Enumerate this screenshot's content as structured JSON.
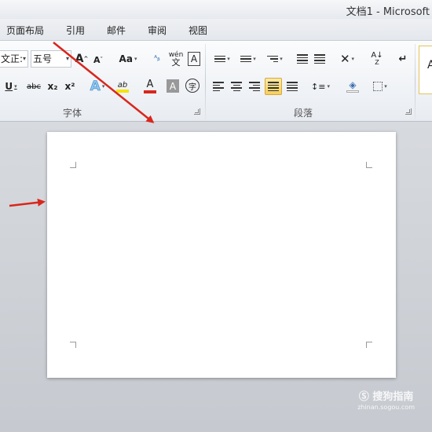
{
  "window": {
    "title": "文档1  -  Microsoft"
  },
  "tabs": [
    {
      "label": "页面布局"
    },
    {
      "label": "引用"
    },
    {
      "label": "邮件"
    },
    {
      "label": "审阅"
    },
    {
      "label": "视图"
    }
  ],
  "font_group": {
    "font_name": "文正:",
    "font_size": "五号",
    "grow_font": "A",
    "shrink_font": "A",
    "change_case": "Aa",
    "phonetic_guide": "wén",
    "char_border": "A",
    "underline": "U",
    "strikethrough": "abc",
    "subscript": "x₂",
    "superscript": "x²",
    "text_effects": "A",
    "highlight": "ab",
    "font_color": "A",
    "char_shading": "A",
    "enclose_char": "字",
    "label": "字体"
  },
  "paragraph_group": {
    "label": "段落"
  },
  "styles_group": {
    "preview": "A"
  },
  "colors": {
    "accent_red": "#d9261c",
    "highlight_yellow": "#f5e300",
    "active_button": "#f7cf5b",
    "ribbon_bg": "#eef1f5",
    "doc_bg": "#c9cdd3"
  },
  "watermark": {
    "brand": "搜狗指南",
    "url": "zhinan.sogou.com"
  }
}
